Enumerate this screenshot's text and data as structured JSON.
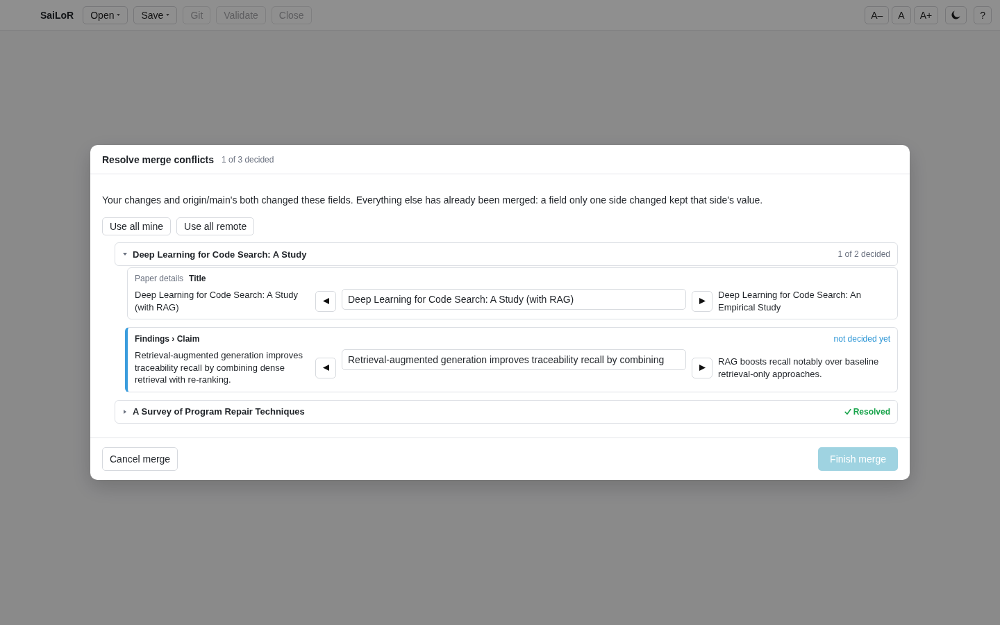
{
  "app_bar": {
    "brand": "SaiLoR",
    "menus": [
      {
        "label": "Open",
        "dropdown": true,
        "disabled": false
      },
      {
        "label": "Save",
        "dropdown": true,
        "disabled": false
      },
      {
        "label": "Git",
        "dropdown": false,
        "disabled": true
      },
      {
        "label": "Validate",
        "dropdown": false,
        "disabled": true
      },
      {
        "label": "Close",
        "dropdown": false,
        "disabled": true
      }
    ],
    "right_buttons": [
      {
        "kind": "font",
        "label": "A–"
      },
      {
        "kind": "font",
        "label": "A"
      },
      {
        "kind": "font",
        "label": "A+"
      },
      {
        "kind": "theme"
      },
      {
        "kind": "help",
        "label": "?"
      }
    ]
  },
  "dialog": {
    "title": "Resolve merge conflicts",
    "progress": "1 of 3 decided",
    "description": "Your changes and origin/main's both changed these fields. Everything else has already been merged: a field only one side changed kept that side's value.",
    "bulk_actions": [
      "Use all mine",
      "Use all remote"
    ],
    "papers": [
      {
        "title": "Deep Learning for Code Search: A Study",
        "expanded": true,
        "resolved": false,
        "status": "1 of 2 decided",
        "fields": [
          {
            "section": "Paper details",
            "name": "Title",
            "decided": true,
            "mine": "Deep Learning for Code Search: A Study (with RAG)",
            "value": "Deep Learning for Code Search: A Study (with RAG)",
            "remote": "Deep Learning for Code Search: An Empirical Study"
          },
          {
            "name": "Findings › Claim",
            "decided": false,
            "status": "not decided yet",
            "mine": "Retrieval-augmented generation improves traceability recall by combining dense retrieval with re-ranking.",
            "value": "Retrieval-augmented generation improves traceability recall by combining",
            "remote": "RAG boosts recall notably over baseline retrieval-only approaches."
          }
        ]
      },
      {
        "title": "A Survey of Program Repair Techniques",
        "expanded": false,
        "resolved": true,
        "status": "Resolved"
      }
    ],
    "footer": {
      "cancel": "Cancel merge",
      "finish": {
        "label": "Finish merge",
        "disabled": true
      }
    }
  }
}
